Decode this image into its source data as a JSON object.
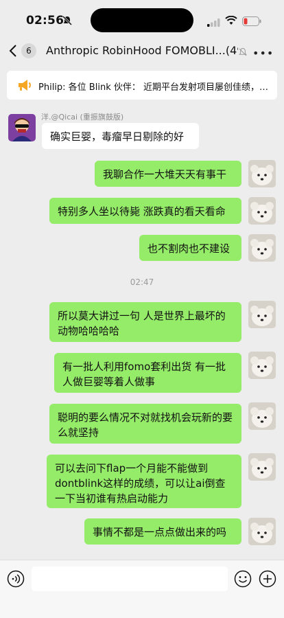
{
  "status_bar": {
    "time": "02:56"
  },
  "nav": {
    "back_count": "6",
    "title": "Anthropic RobinHood FOMOBLI...(499)"
  },
  "pinned_notice": {
    "text": "Philip: 各位 Blink 伙伴：  近期平台发射项目屡创佳绩，…"
  },
  "chat": {
    "incoming_sender": "洋.@Qicai (重振旗鼓版)",
    "incoming_text": "确实巨婴，毒瘤早日剔除的好",
    "timestamp": "02:47",
    "outgoing": [
      "我聊合作一大堆天天有事干",
      "特别多人坐以待毙 涨跌真的看天看命",
      "也不割肉也不建设",
      "所以莫大讲过一句 人是世界上最坏的动物哈哈哈哈",
      "有一批人利用fomo套利出货 有一批人做巨婴等着人做事",
      "聪明的要么情况不对就找机会玩新的要么就坚持",
      "可以去问下flap一个月能不能做到dontblink这样的成绩，可以让ai倒查一下当初谁有热启动能力",
      "事情不都是一点点做出来的吗"
    ]
  },
  "colors": {
    "bubble_outgoing": "#95ec69",
    "bubble_incoming": "#ffffff",
    "chat_background": "#ededed"
  },
  "icons": [
    "mute-bell-icon",
    "signal-icon",
    "wifi-icon",
    "battery-icon",
    "back-chevron-icon",
    "muted-notification-icon",
    "more-icon",
    "speaker-icon",
    "voice-icon",
    "emoji-icon",
    "plus-icon"
  ]
}
